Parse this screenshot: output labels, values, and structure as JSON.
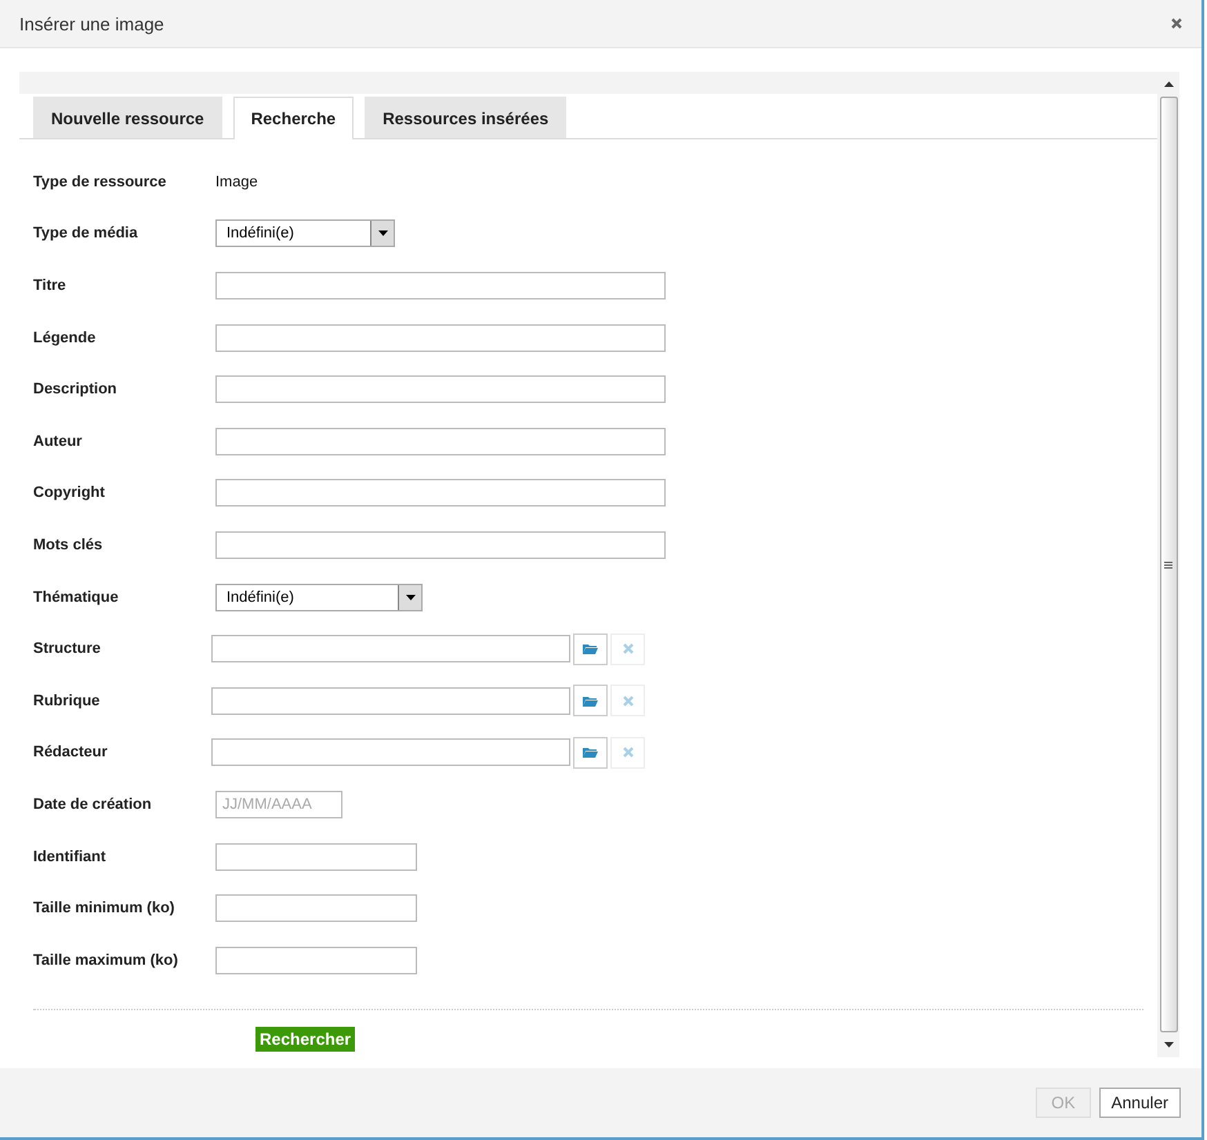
{
  "window": {
    "title": "Insérer une image"
  },
  "tabs": [
    {
      "label": "Nouvelle ressource",
      "selected": false
    },
    {
      "label": "Recherche",
      "selected": true
    },
    {
      "label": "Ressources insérées",
      "selected": false
    }
  ],
  "fields": [
    {
      "kind": "static",
      "label": "Type de ressource",
      "value": "Image"
    },
    {
      "kind": "select",
      "label": "Type de média",
      "value": "Indéfini(e)"
    },
    {
      "kind": "text",
      "label": "Titre"
    },
    {
      "kind": "text",
      "label": "Légende"
    },
    {
      "kind": "text",
      "label": "Description"
    },
    {
      "kind": "text",
      "label": "Auteur"
    },
    {
      "kind": "text",
      "label": "Copyright"
    },
    {
      "kind": "text",
      "label": "Mots clés"
    },
    {
      "kind": "select",
      "label": "Thématique",
      "value": "Indéfini(e)"
    },
    {
      "kind": "picker",
      "label": "Structure"
    },
    {
      "kind": "picker",
      "label": "Rubrique"
    },
    {
      "kind": "picker",
      "label": "Rédacteur"
    },
    {
      "kind": "date",
      "label": "Date de création",
      "placeholder": "JJ/MM/AAAA"
    },
    {
      "kind": "short",
      "label": "Identifiant"
    },
    {
      "kind": "short",
      "label": "Taille minimum (ko)"
    },
    {
      "kind": "short",
      "label": "Taille maximum (ko)"
    }
  ],
  "search_button": {
    "label": "Rechercher"
  },
  "buttons": [
    {
      "label": "OK",
      "disabled": true
    },
    {
      "label": "Annuler",
      "disabled": false
    }
  ]
}
